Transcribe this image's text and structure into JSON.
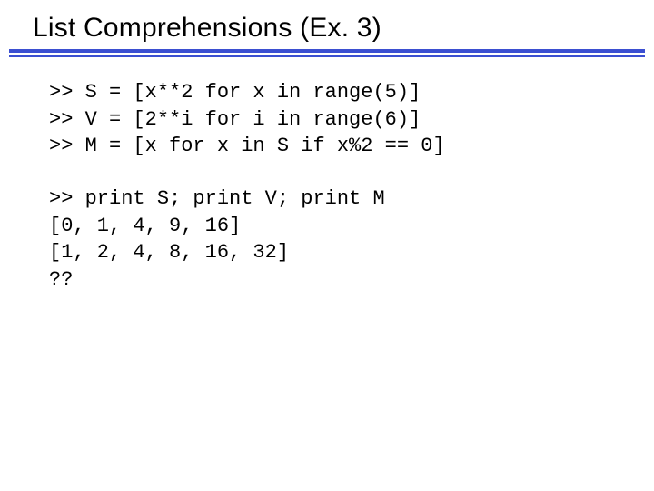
{
  "title": "List Comprehensions (Ex. 3)",
  "code": {
    "defs": ">> S = [x**2 for x in range(5)]\n>> V = [2**i for i in range(6)]\n>> M = [x for x in S if x%2 == 0]",
    "out": ">> print S; print V; print M\n[0, 1, 4, 9, 16]\n[1, 2, 4, 8, 16, 32]\n??"
  },
  "colors": {
    "rule": "#3b4fd1"
  }
}
